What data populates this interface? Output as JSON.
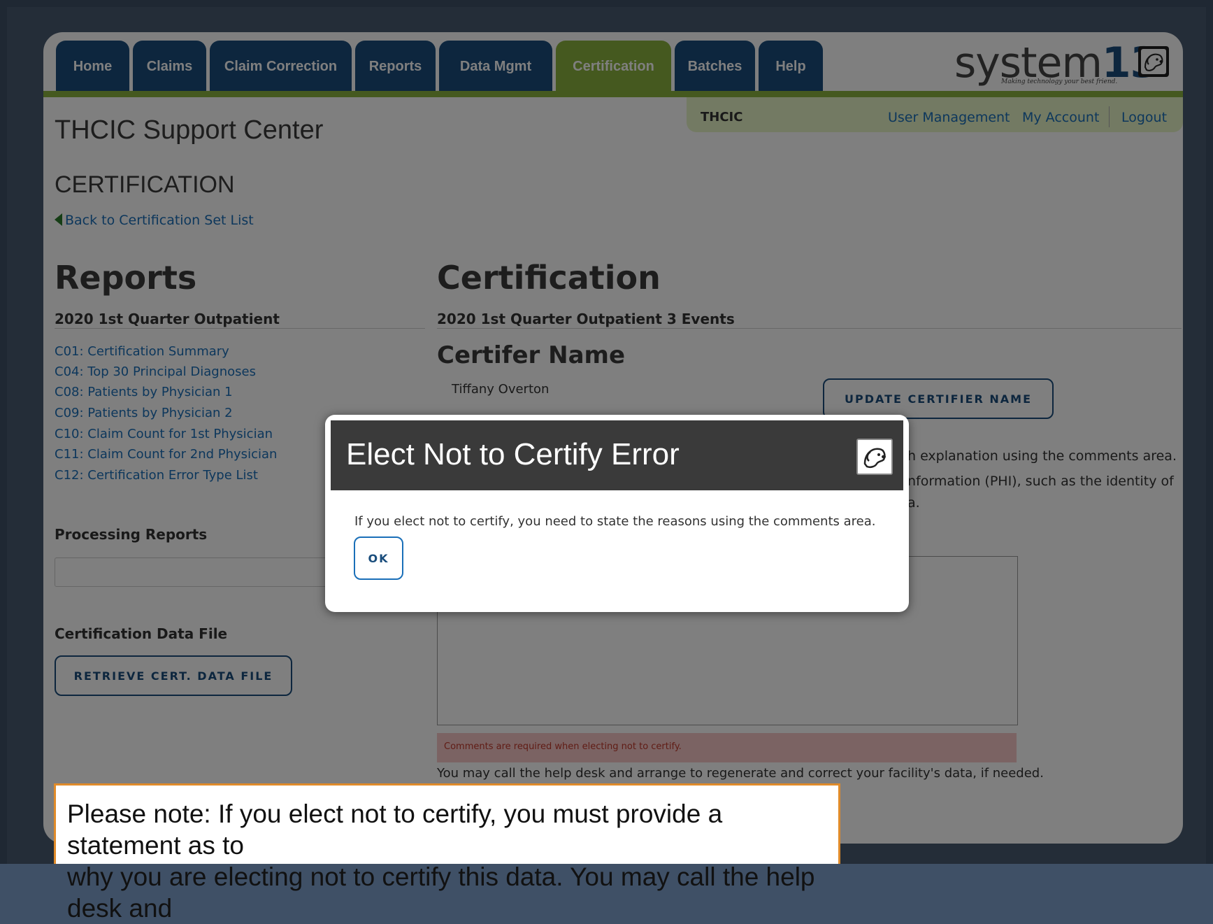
{
  "nav": {
    "tabs": [
      {
        "label": "Home",
        "active": false
      },
      {
        "label": "Claims",
        "active": false
      },
      {
        "label": "Claim Correction",
        "active": false
      },
      {
        "label": "Reports",
        "active": false
      },
      {
        "label": "Data Mgmt",
        "active": false
      },
      {
        "label": "Certification",
        "active": true
      },
      {
        "label": "Batches",
        "active": false
      },
      {
        "label": "Help",
        "active": false
      }
    ]
  },
  "brand": {
    "name_text": "system",
    "name_num": "13",
    "tagline": "Making technology your best friend."
  },
  "user_bar": {
    "org": "THCIC",
    "links": [
      "User Management",
      "My Account",
      "Logout"
    ]
  },
  "site_title": "THCIC Support Center",
  "section_title": "CERTIFICATION",
  "back_link": "Back to Certification Set List",
  "reports": {
    "heading": "Reports",
    "subheading": "2020 1st Quarter Outpatient",
    "links": [
      "C01: Certification Summary",
      "C04: Top 30 Principal Diagnoses",
      "C08: Patients by Physician 1",
      "C09: Patients by Physician 2",
      "C10: Claim Count for 1st Physician",
      "C11: Claim Count for 2nd Physician",
      "C12: Certification Error Type List"
    ],
    "processing_heading": "Processing Reports",
    "cert_file_heading": "Certification Data File",
    "retrieve_button": "RETRIEVE CERT. DATA FILE"
  },
  "certification": {
    "heading": "Certification",
    "subheading": "2020 1st Quarter Outpatient 3 Events",
    "certifier_heading": "Certifer Name",
    "certifier_name": "Tiffany Overton",
    "update_button": "UPDATE CERTIFIER NAME",
    "partial_line_1": "h explanation using the comments area.",
    "partial_line_2": "nformation (PHI), such as the identity of",
    "partial_line_3": "a.",
    "comments_error": "Comments are required when electing not to certify.",
    "help_note": "You may call the help desk and arrange to regenerate and correct your facility's data, if needed."
  },
  "modal": {
    "title": "Elect Not to Certify Error",
    "message": "If you elect not to certify, you need to state the reasons using the comments area.",
    "ok_button": "OK"
  },
  "callout": {
    "line_1": "Please note:  If you elect not to certify, you must provide a statement as to",
    "line_2": "why you are electing not to certify this data. You may call the help desk and"
  },
  "colors": {
    "nav_blue": "#1a4d7c",
    "nav_green": "#8bb23e",
    "link_blue": "#1a6fb8",
    "callout_border": "#e08b2a",
    "error_bg": "#f6c6c6"
  }
}
